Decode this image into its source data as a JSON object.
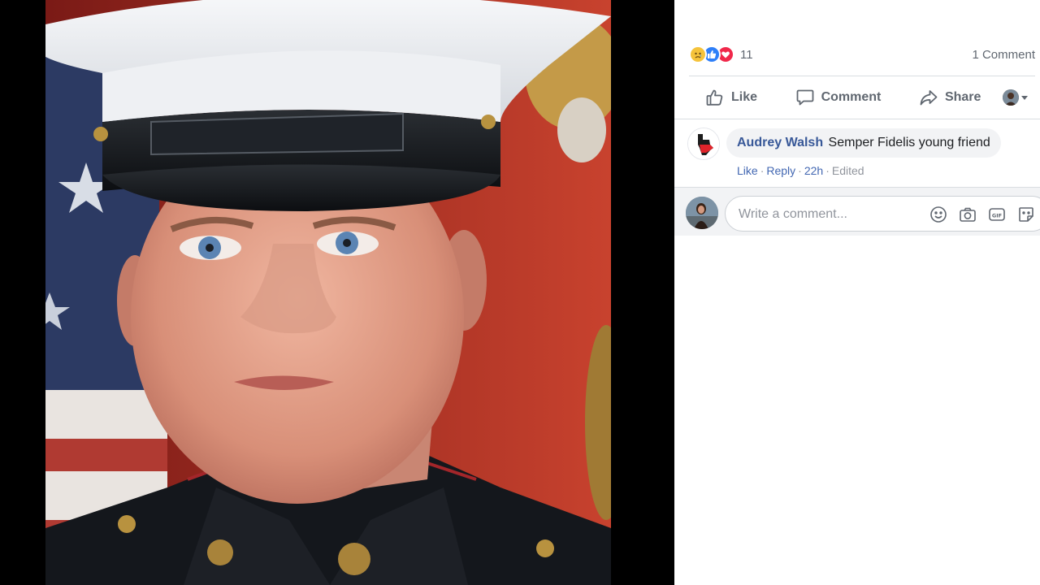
{
  "reactions": {
    "types": [
      "sad",
      "like",
      "love"
    ],
    "count": "11",
    "comments_count_label": "1 Comment"
  },
  "actions": {
    "like_label": "Like",
    "comment_label": "Comment",
    "share_label": "Share"
  },
  "comment": {
    "author": "Audrey Walsh",
    "text": "Semper Fidelis young friend",
    "like_label": "Like",
    "reply_label": "Reply",
    "time": "22h",
    "edited_label": "Edited"
  },
  "composer": {
    "placeholder": "Write a comment...",
    "icons": [
      "emoji-icon",
      "camera-icon",
      "gif-icon",
      "sticker-icon"
    ]
  },
  "colors": {
    "link": "#385898",
    "muted": "#606770",
    "like_blue": "#2e7ff8",
    "love_red": "#f0284a",
    "sad_yellow": "#f5c33b"
  }
}
